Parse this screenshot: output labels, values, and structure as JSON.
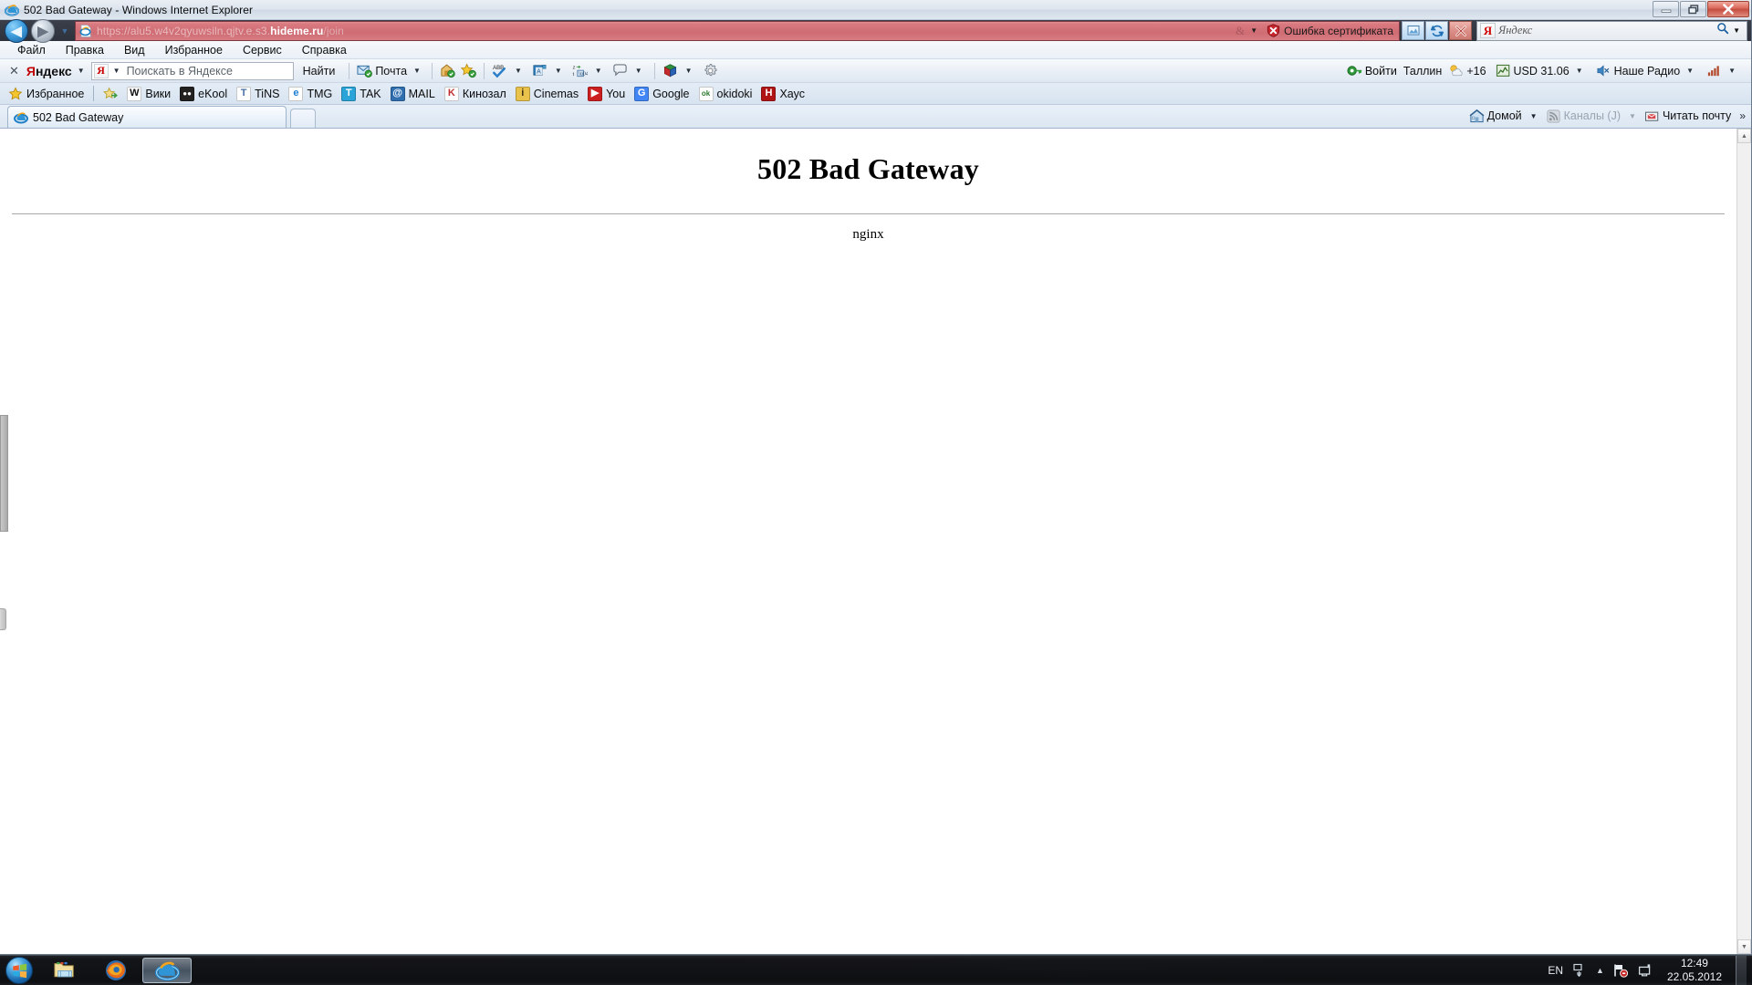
{
  "window": {
    "title": "502 Bad Gateway - Windows Internet Explorer",
    "minimize_label": "—",
    "maximize_label": "❐",
    "close_label": "✕"
  },
  "navbar": {
    "back_label": "◀",
    "forward_label": "▶",
    "recent_label": "▼",
    "url_scheme": "https://alu5.w4v2qyuwsiln.qjtv.e.s3.",
    "url_host": "hideme.ru",
    "url_path": "/join",
    "compat_label": "&",
    "caret_label": "▼",
    "cert_error_label": "Ошибка сертификата",
    "compat_view_title": "Compatibility View",
    "refresh_title": "Refresh",
    "stop_title": "Stop",
    "search": {
      "provider": "Я",
      "placeholder": "Яндекс",
      "caret_label": "▼"
    }
  },
  "menubar": {
    "items": [
      {
        "label": "Файл"
      },
      {
        "label": "Правка"
      },
      {
        "label": "Вид"
      },
      {
        "label": "Избранное"
      },
      {
        "label": "Сервис"
      },
      {
        "label": "Справка"
      }
    ]
  },
  "yandex_toolbar": {
    "close_label": "✕",
    "brand_first": "Я",
    "brand_rest": "ндекс",
    "brand_caret": "▼",
    "input_logo": "Я",
    "input_caret": "▼",
    "input_placeholder": "Поискать в Яндексе",
    "find_label": "Найти",
    "mail_label": "Почта",
    "mail_caret": "▼",
    "icons": {
      "mail": "mail-icon",
      "home_sync": "home-sync-icon",
      "bookmark_star": "bookmark-star-icon",
      "spellcheck": "spellcheck-icon",
      "translate": "translate-icon",
      "transliterate": "transliterate-icon",
      "comment": "comment-icon",
      "cube": "cube-icon",
      "gear": "gear-icon"
    },
    "right": {
      "login_label": "Войти",
      "city_label": "Таллин",
      "weather_label": "+16",
      "currency_label": "USD 31.06",
      "currency_caret": "▼",
      "radio_label": "Наше Радио",
      "radio_caret": "▼",
      "signal_caret": "▼"
    }
  },
  "favorites_bar": {
    "root_label": "Избранное",
    "add_title": "Add to Favorites Bar",
    "items": [
      {
        "label": "Вики",
        "icon": "wikipedia-icon",
        "glyph": "W",
        "fg": "#111111",
        "bg": "#ffffff"
      },
      {
        "label": "eKool",
        "icon": "ekool-icon",
        "glyph": "●●",
        "fg": "#ffffff",
        "bg": "#23211f"
      },
      {
        "label": "TiNS",
        "icon": "tins-icon",
        "glyph": "T",
        "fg": "#4a6fa5",
        "bg": "#ffffff"
      },
      {
        "label": "TMG",
        "icon": "tmg-icon",
        "glyph": "e",
        "fg": "#1c7fd1",
        "bg": "#ffffff"
      },
      {
        "label": "TAK",
        "icon": "tak-icon",
        "glyph": "T",
        "fg": "#ffffff",
        "bg": "#2aa3d8"
      },
      {
        "label": "MAIL",
        "icon": "mail-at-icon",
        "glyph": "@",
        "fg": "#ffffff",
        "bg": "#2f6fb0"
      },
      {
        "label": "Кинозал",
        "icon": "kinozal-icon",
        "glyph": "K",
        "fg": "#c03030",
        "bg": "#ffffff"
      },
      {
        "label": "Cinemas",
        "icon": "cinemas-icon",
        "glyph": "i",
        "fg": "#3a2e10",
        "bg": "#e8c24a"
      },
      {
        "label": "You",
        "icon": "youtube-icon",
        "glyph": "▶",
        "fg": "#ffffff",
        "bg": "#cc2020"
      },
      {
        "label": "Google",
        "icon": "google-icon",
        "glyph": "G",
        "fg": "#ffffff",
        "bg": "#4285f4"
      },
      {
        "label": "okidoki",
        "icon": "okidoki-icon",
        "glyph": "ok",
        "fg": "#2c7a2c",
        "bg": "#ffffff"
      },
      {
        "label": "Хаус",
        "icon": "haus-icon",
        "glyph": "H",
        "fg": "#ffffff",
        "bg": "#b01515"
      }
    ]
  },
  "tabstrip": {
    "tab_label": "502 Bad Gateway",
    "tab_icon": "ie-favicon",
    "new_tab_label": "",
    "new_tab_title": "New Tab",
    "right": {
      "home_label": "Домой",
      "home_caret": "▼",
      "feeds_label": "Каналы (J)",
      "feeds_caret": "▼",
      "mail_label": "Читать почту",
      "overflow_label": "»"
    }
  },
  "page": {
    "heading": "502 Bad Gateway",
    "server": "nginx",
    "scroll_up": "▲",
    "scroll_down": "▼"
  },
  "taskbar": {
    "start_title": "Start",
    "tasks": [
      {
        "name": "explorer",
        "title": "Windows Explorer",
        "active": false
      },
      {
        "name": "firefox",
        "title": "Mozilla Firefox",
        "active": false
      },
      {
        "name": "internet-explorer",
        "title": "Windows Internet Explorer",
        "active": true
      }
    ],
    "tray": {
      "language": "EN",
      "overflow_label": "▲",
      "time": "12:49",
      "date": "22.05.2012"
    }
  }
}
